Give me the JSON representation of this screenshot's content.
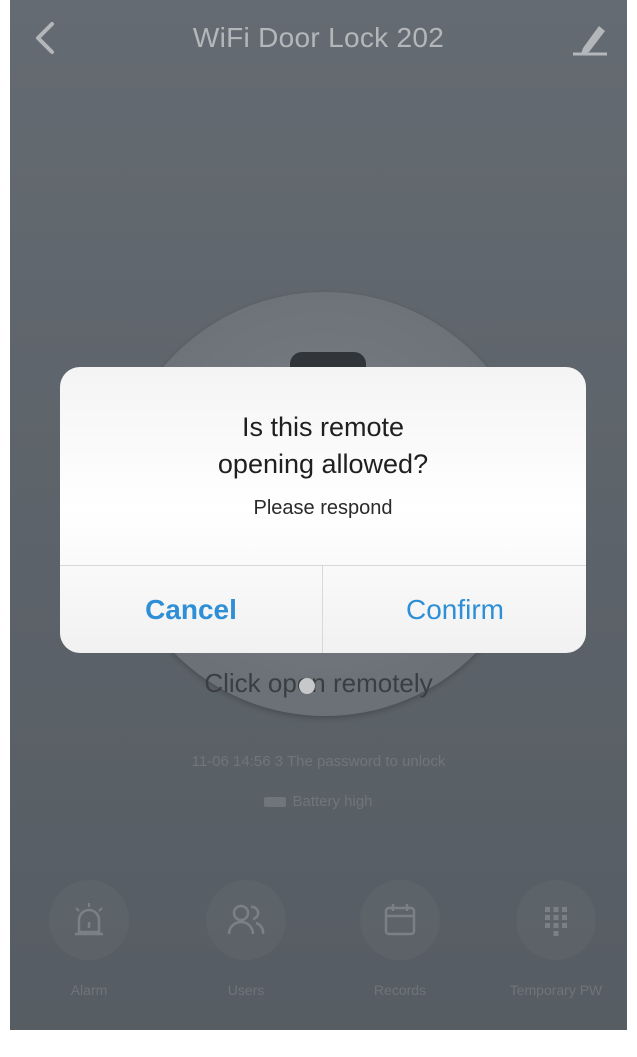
{
  "header": {
    "title": "WiFi Door Lock 202",
    "back_icon": "chevron-left-icon",
    "edit_icon": "pencil-icon"
  },
  "lock": {
    "click_open_label": "Click open remotely",
    "status_line": "11-06 14:56 3 The password to unlock",
    "battery_label": "Battery high"
  },
  "dialog": {
    "title_line1": "Is this remote",
    "title_line2": "opening allowed?",
    "message": "Please respond",
    "cancel_label": "Cancel",
    "confirm_label": "Confirm"
  },
  "nav": {
    "items": [
      {
        "label": "Alarm",
        "icon": "alarm-icon"
      },
      {
        "label": "Users",
        "icon": "users-icon"
      },
      {
        "label": "Records",
        "icon": "calendar-icon"
      },
      {
        "label": "Temporary PW",
        "icon": "keypad-icon"
      }
    ]
  },
  "colors": {
    "accent": "#2f8fd6",
    "background": "#666d74",
    "dialog": "#ffffff"
  }
}
